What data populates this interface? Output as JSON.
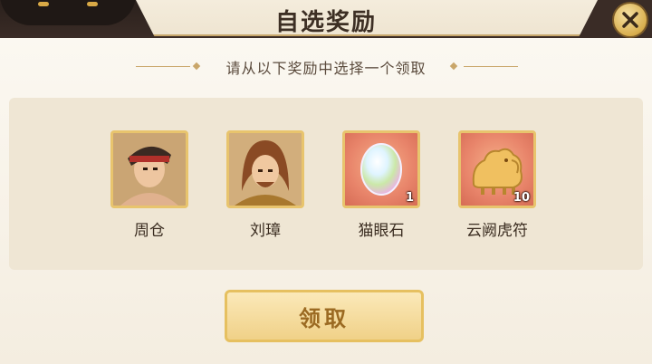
{
  "dialog": {
    "title": "自选奖励",
    "subtitle": "请从以下奖励中选择一个领取",
    "claim_label": "领取"
  },
  "rewards": [
    {
      "name": "周仓",
      "icon": "hero-portrait-icon",
      "count": ""
    },
    {
      "name": "刘璋",
      "icon": "hero-portrait-icon",
      "count": ""
    },
    {
      "name": "猫眼石",
      "icon": "gem-icon",
      "count": "1"
    },
    {
      "name": "云阙虎符",
      "icon": "tiger-tally-icon",
      "count": "10"
    }
  ],
  "colors": {
    "accent_gold": "#e6c060",
    "button_text": "#9b6a22",
    "header_dark": "#3a2c26"
  }
}
